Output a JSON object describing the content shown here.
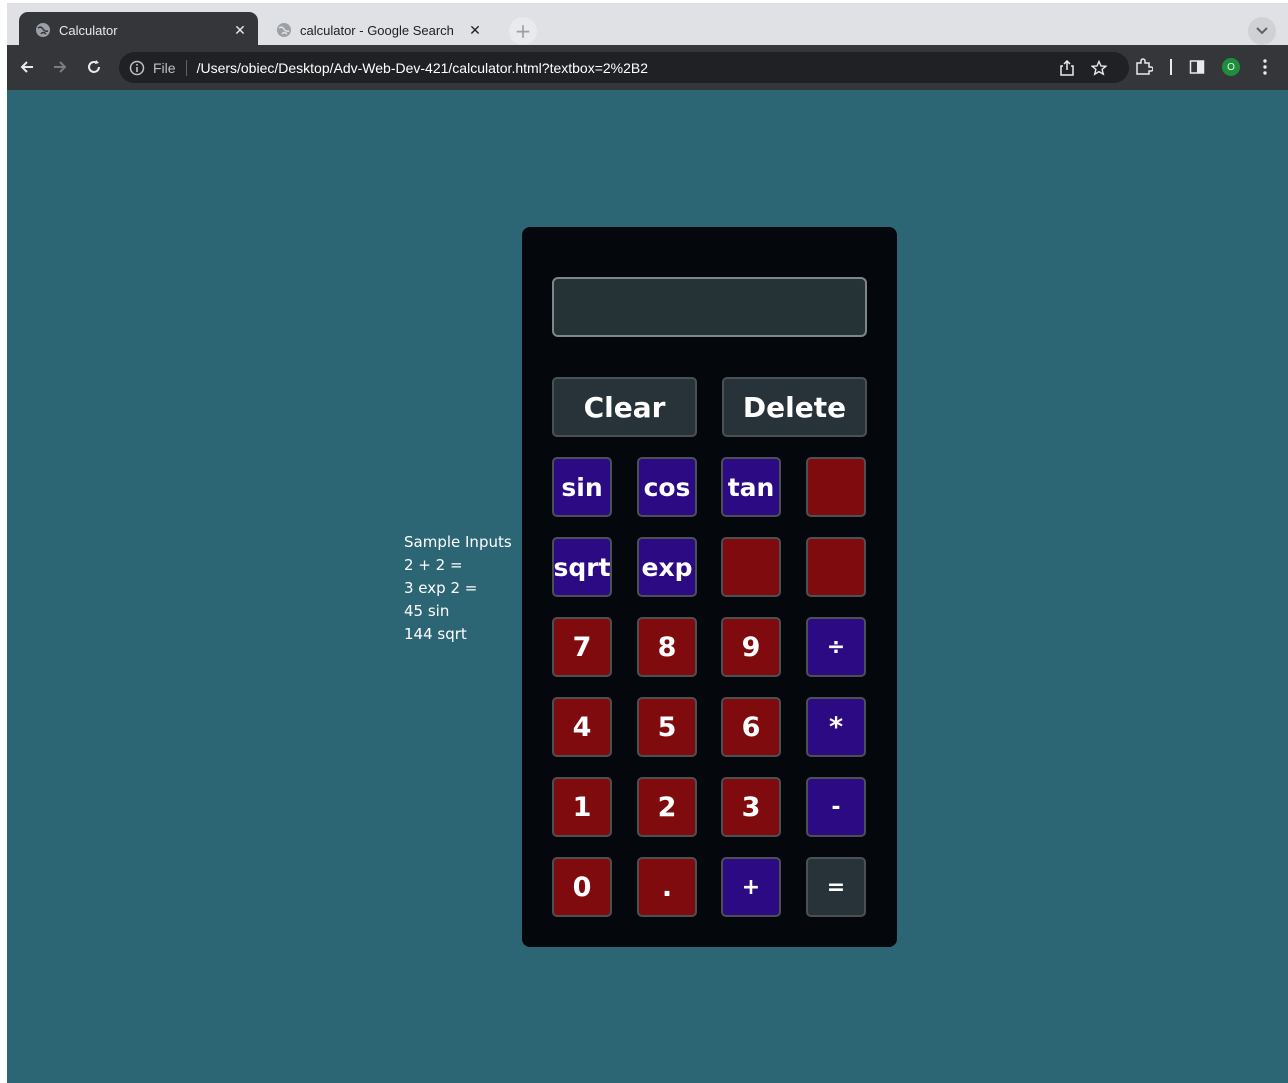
{
  "browser": {
    "tabs": [
      {
        "title": "Calculator",
        "active": true
      },
      {
        "title": "calculator - Google Search",
        "active": false
      }
    ],
    "address": {
      "scheme": "File",
      "url": "/Users/obiec/Desktop/Adv-Web-Dev-421/calculator.html?textbox=2%2B2"
    },
    "profile_initial": "O"
  },
  "samples": {
    "title": "Sample Inputs",
    "lines": [
      "2 + 2 =",
      "3 exp 2 =",
      "45 sin",
      "144 sqrt"
    ]
  },
  "calculator": {
    "display_value": "",
    "clear_label": "Clear",
    "delete_label": "Delete",
    "keys": {
      "sin": "sin",
      "cos": "cos",
      "tan": "tan",
      "sqrt": "sqrt",
      "exp": "exp",
      "seven": "7",
      "eight": "8",
      "nine": "9",
      "divide": "÷",
      "four": "4",
      "five": "5",
      "six": "6",
      "multiply": "*",
      "one": "1",
      "two": "2",
      "three": "3",
      "minus": "-",
      "zero": "0",
      "dot": ".",
      "plus": "+",
      "equals": "="
    }
  },
  "colors": {
    "page_bg": "#2c6574",
    "calc_bg": "#04070b",
    "digit_key": "#800b0e",
    "operator_key": "#2b0a84",
    "neutral_key": "#273338"
  }
}
